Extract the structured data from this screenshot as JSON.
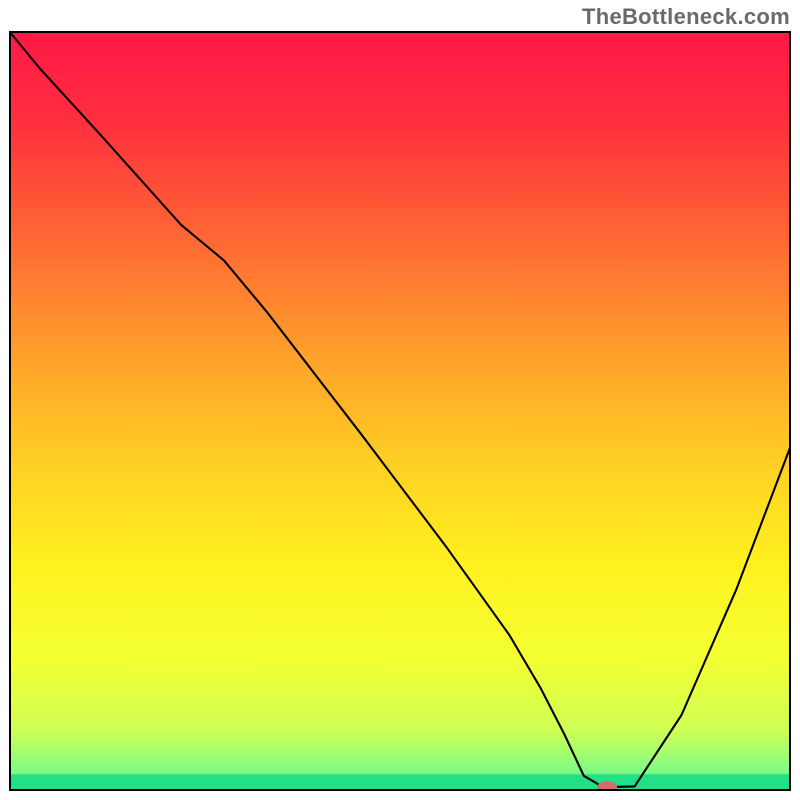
{
  "watermark": "TheBottleneck.com",
  "chart_data": {
    "type": "line",
    "title": "",
    "xlabel": "",
    "ylabel": "",
    "xlim": [
      0,
      100
    ],
    "ylim": [
      0,
      100
    ],
    "grid": false,
    "legend": false,
    "gradient_stops": [
      {
        "offset": 0.0,
        "color": "#ff1846"
      },
      {
        "offset": 0.12,
        "color": "#ff2f3e"
      },
      {
        "offset": 0.28,
        "color": "#ff6a33"
      },
      {
        "offset": 0.44,
        "color": "#ffa52a"
      },
      {
        "offset": 0.58,
        "color": "#ffd223"
      },
      {
        "offset": 0.7,
        "color": "#fff01f"
      },
      {
        "offset": 0.82,
        "color": "#f4ff30"
      },
      {
        "offset": 0.92,
        "color": "#cfff55"
      },
      {
        "offset": 0.975,
        "color": "#7efb84"
      },
      {
        "offset": 1.0,
        "color": "#21e087"
      }
    ],
    "green_band": {
      "y0": 0.0,
      "y1": 2.2,
      "color": "#21e087"
    },
    "series": [
      {
        "name": "bottleneck-curve",
        "x": [
          0.0,
          4.0,
          12.0,
          22.0,
          27.5,
          33.0,
          45.0,
          56.0,
          64.0,
          68.0,
          71.0,
          73.5,
          76.0,
          80.0,
          86.0,
          93.0,
          100.0
        ],
        "y": [
          100.0,
          95.0,
          86.0,
          74.5,
          69.8,
          63.0,
          47.0,
          32.0,
          20.5,
          13.5,
          7.5,
          2.0,
          0.5,
          0.6,
          10.0,
          26.5,
          45.5
        ],
        "color": "#000000",
        "width": 2.1
      }
    ],
    "marker": {
      "x": 76.5,
      "y": 0.5,
      "rx": 10,
      "ry": 6,
      "color": "#d46a6a"
    },
    "frame_stroke": "#000000",
    "frame_width": 2
  }
}
